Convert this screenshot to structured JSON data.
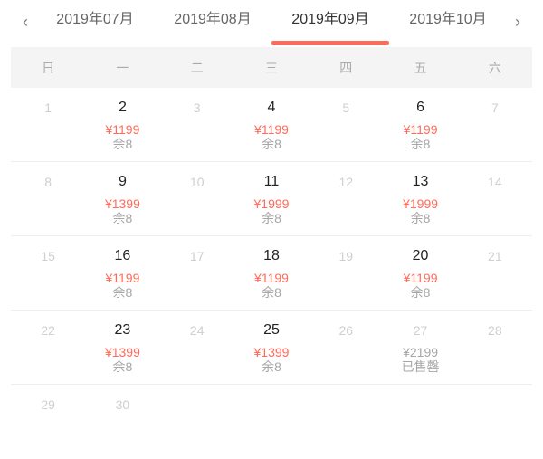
{
  "nav": {
    "prev_icon": "chevron-left-icon",
    "next_icon": "chevron-right-icon",
    "prev_glyph": "‹",
    "next_glyph": "›",
    "tabs": [
      {
        "label": "2019年07月",
        "active": false
      },
      {
        "label": "2019年08月",
        "active": false
      },
      {
        "label": "2019年09月",
        "active": true
      },
      {
        "label": "2019年10月",
        "active": false
      }
    ],
    "accent_color": "#ff6b5a"
  },
  "weekdays": [
    "日",
    "一",
    "二",
    "三",
    "四",
    "五",
    "六"
  ],
  "weeks": [
    [
      {
        "day": "1",
        "status": "disabled"
      },
      {
        "day": "2",
        "status": "available",
        "price": "¥1199",
        "stock": "余8"
      },
      {
        "day": "3",
        "status": "disabled"
      },
      {
        "day": "4",
        "status": "available",
        "price": "¥1199",
        "stock": "余8"
      },
      {
        "day": "5",
        "status": "disabled"
      },
      {
        "day": "6",
        "status": "available",
        "price": "¥1199",
        "stock": "余8"
      },
      {
        "day": "7",
        "status": "disabled"
      }
    ],
    [
      {
        "day": "8",
        "status": "disabled"
      },
      {
        "day": "9",
        "status": "available",
        "price": "¥1399",
        "stock": "余8"
      },
      {
        "day": "10",
        "status": "disabled"
      },
      {
        "day": "11",
        "status": "available",
        "price": "¥1999",
        "stock": "余8"
      },
      {
        "day": "12",
        "status": "disabled"
      },
      {
        "day": "13",
        "status": "available",
        "price": "¥1999",
        "stock": "余8"
      },
      {
        "day": "14",
        "status": "disabled"
      }
    ],
    [
      {
        "day": "15",
        "status": "disabled"
      },
      {
        "day": "16",
        "status": "available",
        "price": "¥1199",
        "stock": "余8"
      },
      {
        "day": "17",
        "status": "disabled"
      },
      {
        "day": "18",
        "status": "available",
        "price": "¥1199",
        "stock": "余8"
      },
      {
        "day": "19",
        "status": "disabled"
      },
      {
        "day": "20",
        "status": "available",
        "price": "¥1199",
        "stock": "余8"
      },
      {
        "day": "21",
        "status": "disabled"
      }
    ],
    [
      {
        "day": "22",
        "status": "disabled"
      },
      {
        "day": "23",
        "status": "available",
        "price": "¥1399",
        "stock": "余8"
      },
      {
        "day": "24",
        "status": "disabled"
      },
      {
        "day": "25",
        "status": "available",
        "price": "¥1399",
        "stock": "余8"
      },
      {
        "day": "26",
        "status": "disabled"
      },
      {
        "day": "27",
        "status": "soldout",
        "price": "¥2199",
        "stock": "已售罄"
      },
      {
        "day": "28",
        "status": "disabled"
      }
    ],
    [
      {
        "day": "29",
        "status": "disabled"
      },
      {
        "day": "30",
        "status": "disabled"
      },
      {
        "day": "",
        "status": "empty"
      },
      {
        "day": "",
        "status": "empty"
      },
      {
        "day": "",
        "status": "empty"
      },
      {
        "day": "",
        "status": "empty"
      },
      {
        "day": "",
        "status": "empty"
      }
    ]
  ]
}
